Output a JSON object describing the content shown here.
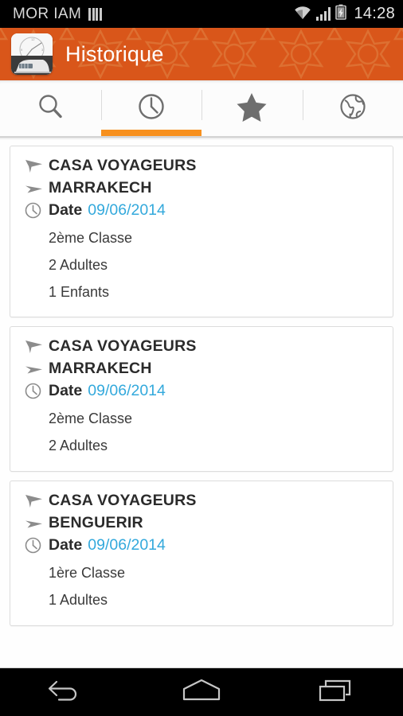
{
  "status_bar": {
    "carrier": "MOR IAM",
    "time": "14:28",
    "icons": [
      "signal-bars-icon",
      "wifi-icon",
      "cellular-signal-icon",
      "battery-charging-icon"
    ]
  },
  "app_bar": {
    "title": "Historique",
    "icon": "clock-train-app-icon",
    "background_color": "#d9561a",
    "pattern": "moroccan-zellige-star-pattern"
  },
  "tabs": [
    {
      "name": "search",
      "icon": "search-icon",
      "active": false
    },
    {
      "name": "history",
      "icon": "clock-icon",
      "active": true
    },
    {
      "name": "favorites",
      "icon": "star-icon",
      "active": false
    },
    {
      "name": "world",
      "icon": "globe-icon",
      "active": false
    }
  ],
  "tab_indicator_color": "#f7901e",
  "history": {
    "date_label": "Date",
    "date_color": "#33a9dc",
    "entries": [
      {
        "departure": "CASA VOYAGEURS",
        "arrival": "MARRAKECH",
        "date": "09/06/2014",
        "details": [
          "2ème Classe",
          "2 Adultes",
          "1 Enfants"
        ]
      },
      {
        "departure": "CASA VOYAGEURS",
        "arrival": "MARRAKECH",
        "date": "09/06/2014",
        "details": [
          "2ème Classe",
          "2 Adultes"
        ]
      },
      {
        "departure": "CASA VOYAGEURS",
        "arrival": "BENGUERIR",
        "date": "09/06/2014",
        "details": [
          "1ère Classe",
          "1 Adultes"
        ]
      }
    ]
  },
  "nav_bar": {
    "buttons": [
      {
        "name": "back",
        "icon": "back-arrow-icon"
      },
      {
        "name": "home",
        "icon": "home-icon"
      },
      {
        "name": "recents",
        "icon": "recent-apps-icon"
      }
    ]
  }
}
